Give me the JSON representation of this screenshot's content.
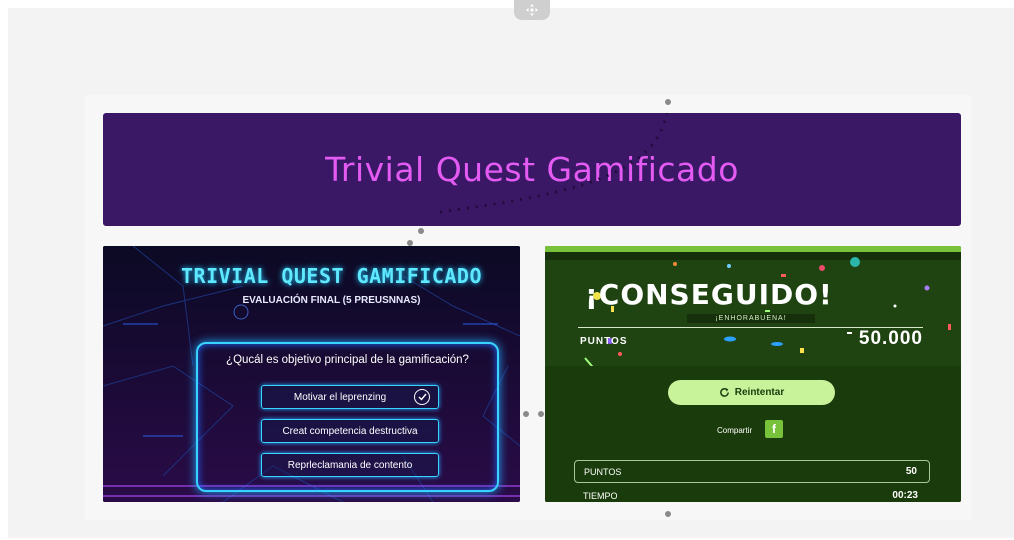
{
  "banner": {
    "title": "Trivial Quest Gamificado"
  },
  "quiz_card": {
    "title": "TRIVIAL QUEST GAMIFICADO",
    "subtitle": "EVALUACIÓN FINAL (5 PREUSNNAS)",
    "question": "¿Qucál es objetivo principal de la gamificación?",
    "answers": [
      {
        "label": "Motivar el leprenzing",
        "selected": true
      },
      {
        "label": "Creat competencia destructiva",
        "selected": false
      },
      {
        "label": "Reprleclamania de contento",
        "selected": false
      }
    ]
  },
  "result_card": {
    "headline": "¡CONSEGUIDO!",
    "subheadline": "¡ENHORABUENA!",
    "points_label": "PUNTOS",
    "points_value": "50.000",
    "retry_label": "Reintentar",
    "share_label": "Compartir",
    "share_icon": "f",
    "stats": [
      {
        "label": "PUNTOS",
        "value": "50"
      },
      {
        "label": "TIEMPO",
        "value": "00:23"
      }
    ]
  },
  "colors": {
    "banner_bg": "#3b1866",
    "banner_text": "#e35bf2",
    "neon_cyan": "#39d3ff",
    "result_bg": "#1f4412",
    "result_accent": "#78c13a",
    "retry_bg": "#c8f39b"
  },
  "icons": {
    "top_handle": "move-icon",
    "check": "check-circle-icon",
    "retry": "refresh-icon",
    "share": "facebook-icon"
  }
}
